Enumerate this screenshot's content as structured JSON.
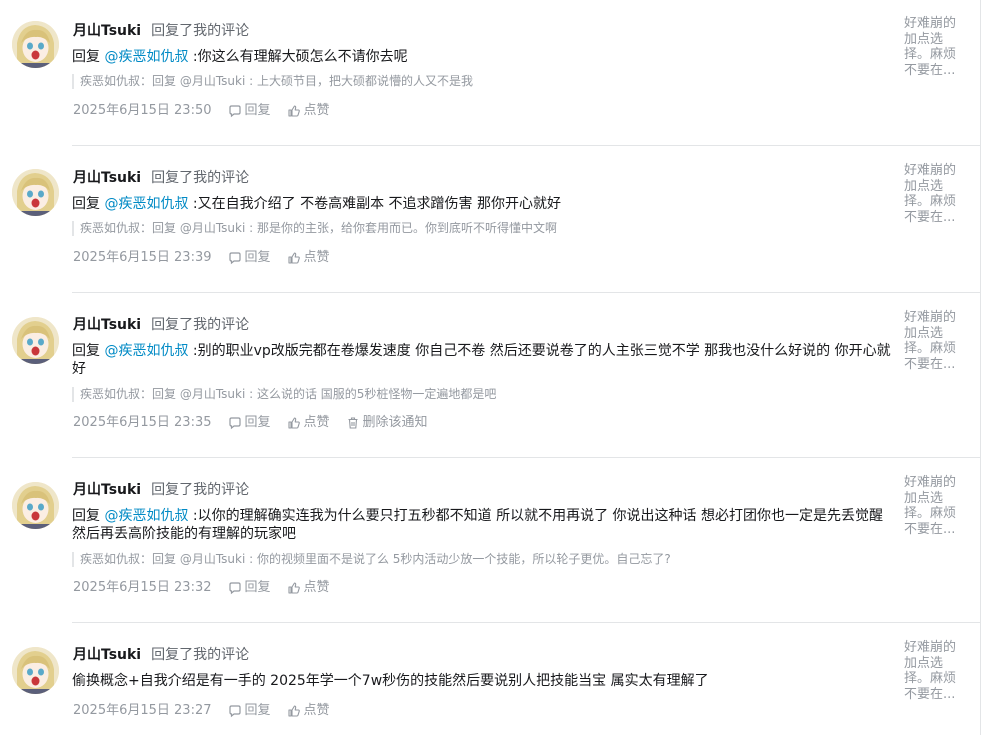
{
  "notifications": [
    {
      "user": "月山Tsuki",
      "action": "回复了我的评论",
      "reply_prefix": "回复 ",
      "mention": "@疾恶如仇叔",
      "text": " :你这么有理解大硕怎么不请你去呢",
      "quote": "疾恶如仇叔：回复 @月山Tsuki : 上大硕节目，把大硕都说懵的人又不是我",
      "time": "2025年6月15日 23:50",
      "reply_label": "回复",
      "like_label": "点赞",
      "side_text": "好难崩的加点选择。麻烦不要在..."
    },
    {
      "user": "月山Tsuki",
      "action": "回复了我的评论",
      "reply_prefix": "回复 ",
      "mention": "@疾恶如仇叔",
      "text": " :又在自我介绍了 不卷高难副本 不追求蹭伤害 那你开心就好",
      "quote": "疾恶如仇叔：回复 @月山Tsuki : 那是你的主张，给你套用而已。你到底听不听得懂中文啊",
      "time": "2025年6月15日 23:39",
      "reply_label": "回复",
      "like_label": "点赞",
      "side_text": "好难崩的加点选择。麻烦不要在..."
    },
    {
      "user": "月山Tsuki",
      "action": "回复了我的评论",
      "reply_prefix": "回复 ",
      "mention": "@疾恶如仇叔",
      "text": " :别的职业vp改版完都在卷爆发速度 你自己不卷 然后还要说卷了的人主张三觉不学 那我也没什么好说的 你开心就好",
      "quote": "疾恶如仇叔：回复 @月山Tsuki : 这么说的话 国服的5秒桩怪物一定遍地都是吧",
      "time": "2025年6月15日 23:35",
      "reply_label": "回复",
      "like_label": "点赞",
      "delete_label": "删除该通知",
      "side_text": "好难崩的加点选择。麻烦不要在..."
    },
    {
      "user": "月山Tsuki",
      "action": "回复了我的评论",
      "reply_prefix": "回复 ",
      "mention": "@疾恶如仇叔",
      "text": " :以你的理解确实连我为什么要只打五秒都不知道 所以就不用再说了 你说出这种话 想必打团你也一定是先丢觉醒然后再丢高阶技能的有理解的玩家吧",
      "quote": "疾恶如仇叔：回复 @月山Tsuki : 你的视频里面不是说了么 5秒内活动少放一个技能，所以轮子更优。自己忘了?",
      "time": "2025年6月15日 23:32",
      "reply_label": "回复",
      "like_label": "点赞",
      "side_text": "好难崩的加点选择。麻烦不要在..."
    },
    {
      "user": "月山Tsuki",
      "action": "回复了我的评论",
      "text": "偷换概念+自我介绍是有一手的 2025年学一个7w秒伤的技能然后要说别人把技能当宝 属实太有理解了",
      "time": "2025年6月15日 23:27",
      "reply_label": "回复",
      "like_label": "点赞",
      "side_text": "好难崩的加点选择。麻烦不要在..."
    }
  ]
}
